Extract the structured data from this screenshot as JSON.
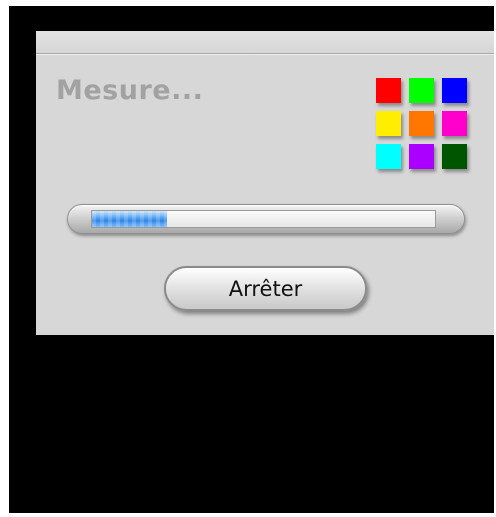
{
  "dialog": {
    "title": "Mesure...",
    "stop_label": "Arrêter",
    "progress": 0.22
  },
  "palette": {
    "colors": [
      "#ff0000",
      "#00ff00",
      "#0000ff",
      "#ffee00",
      "#ff7700",
      "#ff00cc",
      "#00ffff",
      "#aa00ff",
      "#005500"
    ]
  }
}
